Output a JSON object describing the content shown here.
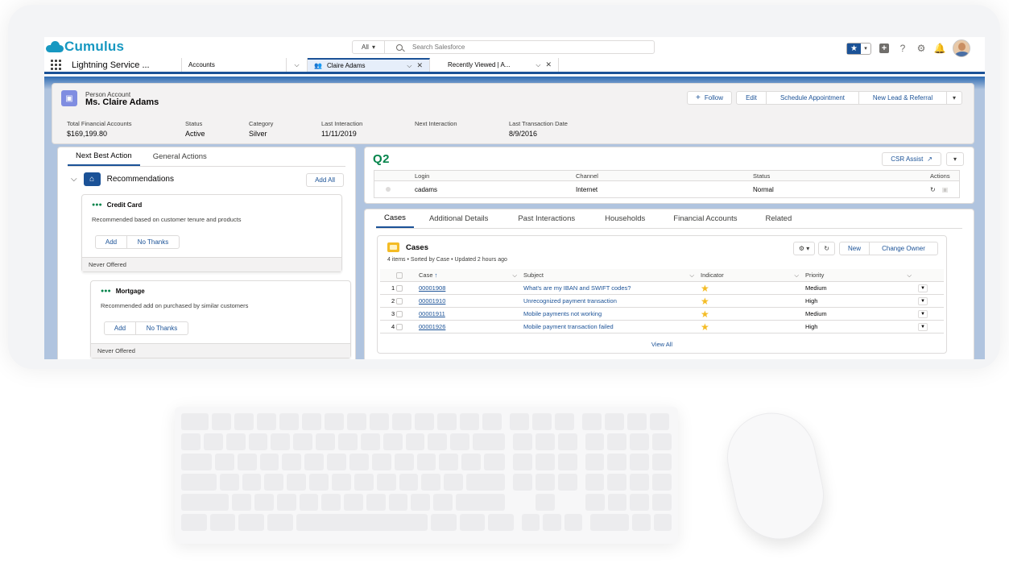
{
  "header": {
    "brand": "Cumulus",
    "search_scope": "All",
    "search_placeholder": "Search Salesforce"
  },
  "nav": {
    "app_name": "Lightning Service ...",
    "tabs": [
      {
        "label": "Accounts"
      },
      {
        "label": "Claire Adams"
      },
      {
        "label": "Recently Viewed | A..."
      }
    ]
  },
  "record": {
    "type": "Person Account",
    "name": "Ms. Claire Adams",
    "actions": {
      "follow": "Follow",
      "edit": "Edit",
      "schedule": "Schedule Appointment",
      "new_lead": "New Lead & Referral"
    },
    "highlights": [
      {
        "label": "Total Financial Accounts",
        "value": "$169,199.80"
      },
      {
        "label": "Status",
        "value": "Active"
      },
      {
        "label": "Category",
        "value": "Silver"
      },
      {
        "label": "Last Interaction",
        "value": "11/11/2019"
      },
      {
        "label": "Next Interaction",
        "value": ""
      },
      {
        "label": "Last Transaction Date",
        "value": "8/9/2016"
      }
    ]
  },
  "left_panel": {
    "tabs": [
      "Next Best Action",
      "General Actions"
    ],
    "section_title": "Recommendations",
    "add_all": "Add All",
    "cards": [
      {
        "title": "Credit Card",
        "desc": "Recommended based on customer tenure and products",
        "add": "Add",
        "no_thanks": "No Thanks",
        "footer": "Never Offered"
      },
      {
        "title": "Mortgage",
        "desc": "Recommended add on purchased by similar customers",
        "add": "Add",
        "no_thanks": "No Thanks",
        "footer": "Never Offered"
      }
    ]
  },
  "q2": {
    "logo": "Q2",
    "csr_assist": "CSR Assist",
    "columns": [
      "Login",
      "Channel",
      "Status",
      "Actions"
    ],
    "row": {
      "login": "cadams",
      "channel": "Internet",
      "status": "Normal"
    }
  },
  "right_panel": {
    "tabs": [
      "Cases",
      "Additional Details",
      "Past Interactions",
      "Households",
      "Financial Accounts",
      "Related"
    ],
    "cases": {
      "title": "Cases",
      "subtitle": "4 items • Sorted by Case • Updated 2 hours ago",
      "new": "New",
      "change_owner": "Change Owner",
      "columns": {
        "case": "Case",
        "subject": "Subject",
        "indicator": "Indicator",
        "priority": "Priority"
      },
      "rows": [
        {
          "n": "1",
          "case": "00001908",
          "subject": "What's are my IBAN and SWIFT codes?",
          "priority": "Medium"
        },
        {
          "n": "2",
          "case": "00001910",
          "subject": "Unrecognized payment transaction",
          "priority": "High"
        },
        {
          "n": "3",
          "case": "00001911",
          "subject": "Mobile payments not working",
          "priority": "Medium"
        },
        {
          "n": "4",
          "case": "00001926",
          "subject": "Mobile payment transaction failed",
          "priority": "High"
        }
      ],
      "view_all": "View All"
    }
  },
  "colors": {
    "brand": "#1798c1",
    "nav_accent": "#1b5297",
    "q2_green": "#04844b",
    "star": "#f4bc25"
  }
}
